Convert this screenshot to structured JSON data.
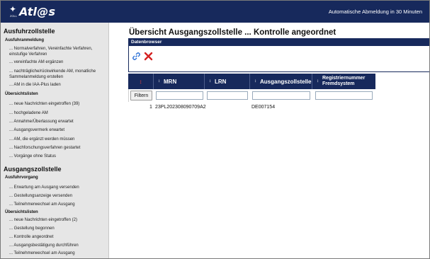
{
  "header": {
    "logo_text": "Atl@s",
    "logo_sub": "ZOLL",
    "logout_notice": "Automatische Abmeldung in 30 Minuten"
  },
  "sidebar": {
    "ausfuhr": {
      "title": "Ausfuhrzollstelle",
      "anmeldung_title": "Ausfuhranmeldung",
      "anmeldung_items": [
        "... Normalverfahren, Vereinfachte Verfahren, einstufige Verfahren",
        "... vereinfachte AM ergänzen",
        "... nachträgliche/rückwirkende AM, monatliche Sammelanmeldung erstellen",
        "... AM in die IAA-Plus laden"
      ],
      "listen_title": "Übersichtslisten",
      "listen_items": [
        "... neue Nachrichten eingetroffen (39)",
        "... hochgeladene AM",
        "... Annahme/Überlassung erwartet",
        "... Ausgangsvermerk erwartet",
        "... AM, die ergänzt werden müssen",
        "... Nachforschungsverfahren gestartet",
        "... Vorgänge ohne Status"
      ]
    },
    "ausgang": {
      "title": "Ausgangszollstelle",
      "vorgang_title": "Ausfuhrvorgang",
      "vorgang_items": [
        "... Erwartung am Ausgang versenden",
        "... Gestellungsanzeige versenden",
        "... Teilnehmerwechsel am Ausgang"
      ],
      "listen_title": "Übersichtslisten",
      "listen_items": [
        "... neue Nachrichten eingetroffen (2)",
        "... Gestellung begonnen",
        "... Kontrolle angeordnet",
        "... Ausgangsbestätigung durchführen",
        "... Teilnehmerwechsel am Ausgang"
      ]
    }
  },
  "main": {
    "title": "Übersicht Ausgangszollstelle ... Kontrolle angeordnet",
    "browser_label": "Datenbrowser",
    "tools": {
      "link_icon": "link-icon",
      "delete_icon": "delete-x-icon"
    },
    "table": {
      "columns": [
        "MRN",
        "LRN",
        "Ausgangszollstelle",
        "Registriernummer Fremdsystem"
      ],
      "sort_arrows": "↕",
      "filter_label": "Filtern",
      "rows": [
        {
          "index": "1",
          "mrn": "23PL202308090709A2",
          "lrn": "",
          "ausgangszollstelle": "DE007154",
          "registriernummer": ""
        }
      ]
    }
  },
  "colors": {
    "header_bg": "#17295c",
    "sidebar_bg": "#e6e6e6",
    "delete_red": "#d42020",
    "link_blue": "#2a6fd6"
  }
}
